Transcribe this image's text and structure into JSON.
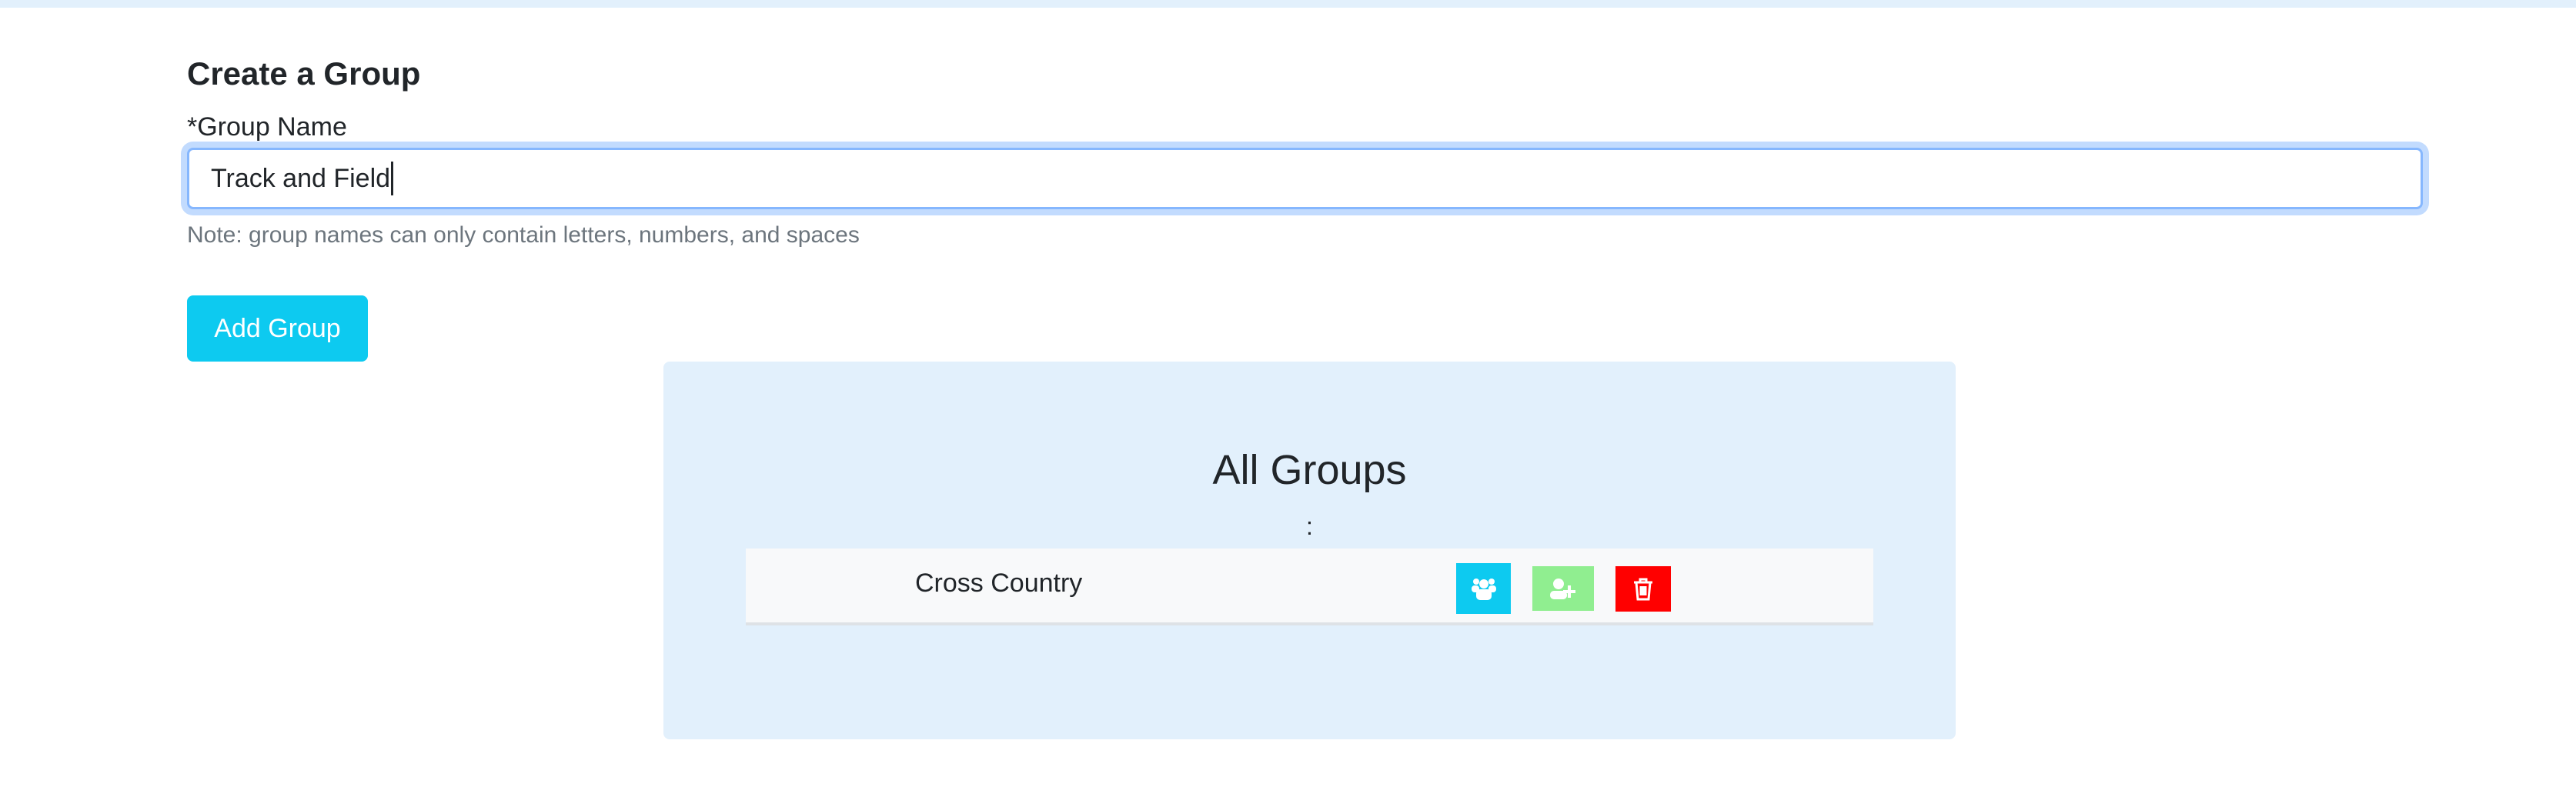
{
  "form": {
    "heading": "Create a Group",
    "group_name_label": "*Group Name",
    "group_name_value": "Track and Field",
    "note": "Note: group names can only contain letters, numbers, and spaces",
    "add_button_label": "Add Group"
  },
  "groups_panel": {
    "title": "All Groups",
    "separator": ":",
    "groups": [
      {
        "name": "Cross Country",
        "actions": [
          {
            "icon": "users-icon",
            "color": "#0dcaf0"
          },
          {
            "icon": "user-plus-icon",
            "color": "#90ee90"
          },
          {
            "icon": "trash-icon",
            "color": "#ff0000"
          }
        ]
      }
    ]
  }
}
